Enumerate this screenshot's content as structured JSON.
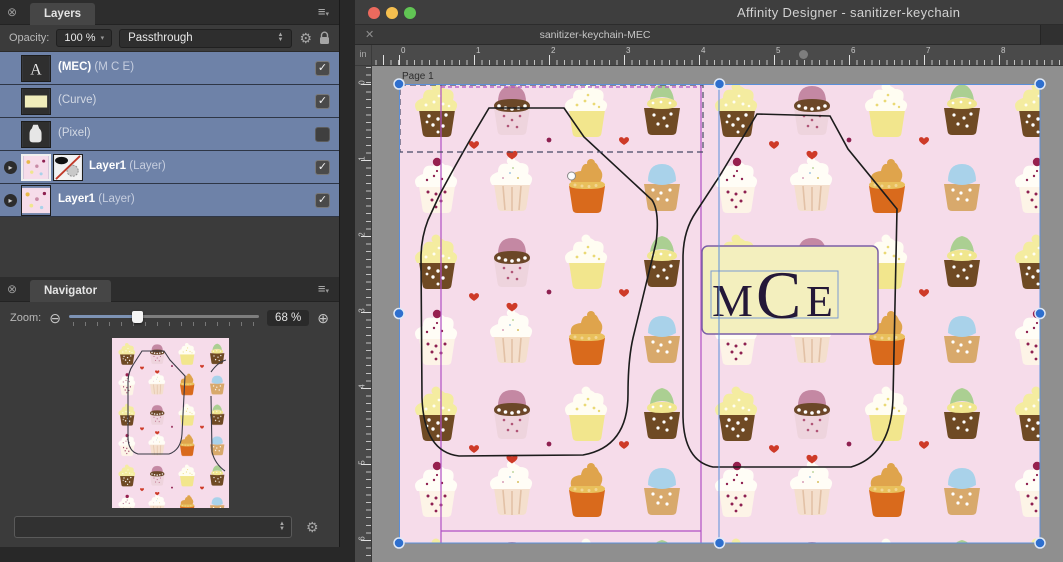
{
  "window": {
    "title": "Affinity Designer - sanitizer-keychain",
    "doc_tab": "sanitizer-keychain-MEC"
  },
  "layers_panel": {
    "tab": "Layers",
    "opacity_label": "Opacity:",
    "opacity_value": "100 %",
    "blend_mode": "Passthrough",
    "layers": [
      {
        "name": "(MEC)",
        "detail": "(M C E)",
        "visible": true,
        "thumbs": [
          "text-a"
        ],
        "muted": false,
        "expandable": false
      },
      {
        "name": "(Curve)",
        "detail": "",
        "visible": true,
        "thumbs": [
          "curve"
        ],
        "muted": true,
        "expandable": false
      },
      {
        "name": "(Pixel)",
        "detail": "",
        "visible": false,
        "thumbs": [
          "pixel"
        ],
        "muted": true,
        "expandable": false
      },
      {
        "name": "Layer1",
        "detail": "(Layer)",
        "visible": true,
        "thumbs": [
          "pattern",
          "mask"
        ],
        "muted": false,
        "expandable": true,
        "thumb_selected": 0
      },
      {
        "name": "Layer1",
        "detail": "(Layer)",
        "visible": true,
        "thumbs": [
          "pattern"
        ],
        "muted": false,
        "expandable": true,
        "tall_thumb": true
      }
    ]
  },
  "navigator_panel": {
    "tab": "Navigator",
    "zoom_label": "Zoom:",
    "zoom_value": "68 %"
  },
  "rulers": {
    "unit": "in",
    "h": [
      "0",
      "1",
      "2",
      "3",
      "4",
      "5",
      "6",
      "7",
      "8"
    ],
    "v": [
      "0",
      "1",
      "2",
      "3",
      "4",
      "5",
      "6"
    ]
  },
  "canvas": {
    "page_label": "Page 1",
    "monogram": {
      "m": "M",
      "c": "C",
      "e": "E"
    }
  },
  "colors": {
    "layer_row_blue": "#6e82a8",
    "page_pink": "#f6dcea",
    "pasteboard_gray": "#8f8f8f",
    "magenta_guide": "#b04fc4",
    "blue_guide": "#5b8fd9",
    "selection_handle_blue": "#2e6fce",
    "monogram_bg": "#f3efbe",
    "monogram_border": "#7b5fa6",
    "monogram_text": "#241838",
    "outline_black": "#1c1c1c",
    "traffic_red": "#ec6a5e",
    "traffic_yellow": "#f5bf4f",
    "traffic_green": "#61c554"
  }
}
